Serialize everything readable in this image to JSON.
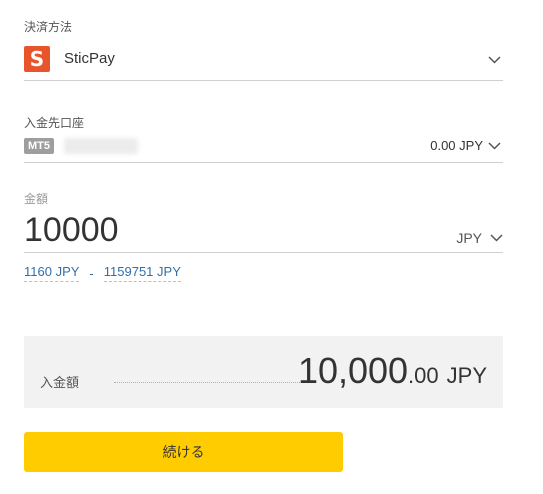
{
  "payment": {
    "label": "決済方法",
    "logo_letter": "S",
    "method": "SticPay"
  },
  "account": {
    "label": "入金先口座",
    "badge": "MT5",
    "balance": "0.00 JPY"
  },
  "amount": {
    "label": "金額",
    "value": "10000",
    "currency": "JPY",
    "min": "1160 JPY",
    "separator": "-",
    "max": "1159751 JPY"
  },
  "summary": {
    "label": "入金額",
    "amount_main": "10,000",
    "amount_decimal": ".00",
    "currency": "JPY"
  },
  "submit": {
    "label": "続ける"
  },
  "colors": {
    "accent_button": "#ffcc00",
    "logo": "#e9552a",
    "link": "#2f6fa8"
  }
}
